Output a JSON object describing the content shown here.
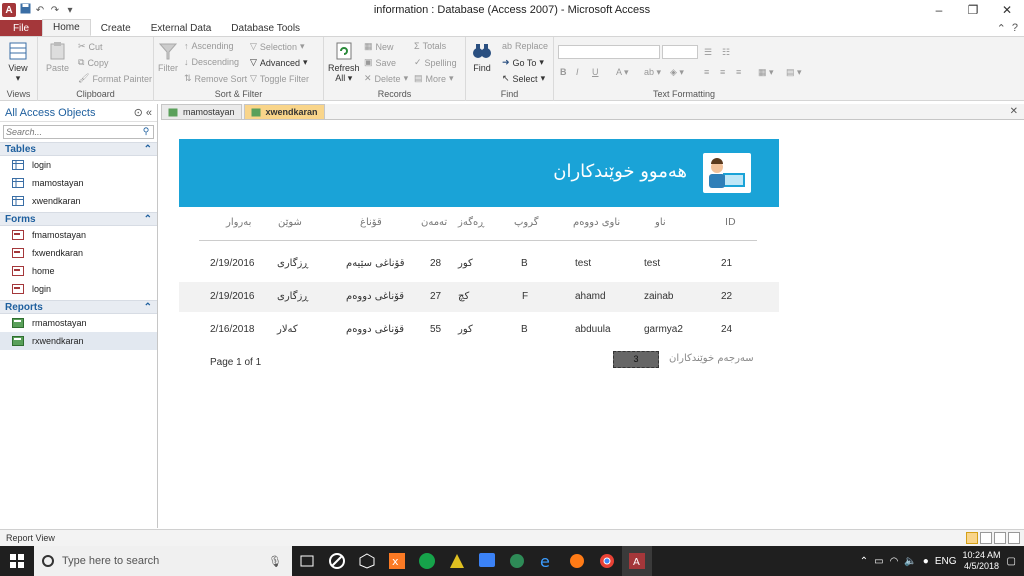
{
  "window": {
    "title": "information : Database (Access 2007) - Microsoft Access"
  },
  "ribbon_tabs": [
    "File",
    "Home",
    "Create",
    "External Data",
    "Database Tools"
  ],
  "ribbon": {
    "views": {
      "view_label": "View",
      "group_label": "Views"
    },
    "clipboard": {
      "paste": "Paste",
      "cut": "Cut",
      "copy": "Copy",
      "format_painter": "Format Painter",
      "group_label": "Clipboard"
    },
    "sort_filter": {
      "filter": "Filter",
      "ascending": "Ascending",
      "descending": "Descending",
      "remove_sort": "Remove Sort",
      "selection": "Selection",
      "advanced": "Advanced",
      "toggle_filter": "Toggle Filter",
      "group_label": "Sort & Filter"
    },
    "records": {
      "refresh": "Refresh",
      "refresh_all": "All",
      "new": "New",
      "save": "Save",
      "delete": "Delete",
      "totals": "Totals",
      "spelling": "Spelling",
      "more": "More",
      "group_label": "Records"
    },
    "find": {
      "find": "Find",
      "replace": "Replace",
      "go_to": "Go To",
      "select": "Select",
      "group_label": "Find"
    },
    "text_formatting": {
      "group_label": "Text Formatting"
    }
  },
  "nav": {
    "header": "All Access Objects",
    "search_placeholder": "Search...",
    "sections": [
      {
        "title": "Tables",
        "items": [
          "login",
          "mamostayan",
          "xwendkaran"
        ]
      },
      {
        "title": "Forms",
        "items": [
          "fmamostayan",
          "fxwendkaran",
          "home",
          "login"
        ]
      },
      {
        "title": "Reports",
        "items": [
          "rmamostayan",
          "rxwendkaran"
        ]
      }
    ]
  },
  "doc_tabs": [
    "mamostayan",
    "xwendkaran"
  ],
  "report": {
    "title": "هەموو خوێندکاران",
    "columns": {
      "id": "ID",
      "name": "ناو",
      "second_name": "ناوی دووەم",
      "group": "گروپ",
      "gender": "ڕەگەز",
      "age": "تەمەن",
      "stage": "قۆناغ",
      "place": "شوێن",
      "date": "بەروار"
    },
    "rows": [
      {
        "id": "21",
        "name": "test",
        "second_name": "test",
        "group": "B",
        "gender": "کور",
        "age": "28",
        "stage": "قۆناغی سێیەم",
        "place": "ڕزگاری",
        "date": "2/19/2016"
      },
      {
        "id": "22",
        "name": "zainab",
        "second_name": "ahamd",
        "group": "F",
        "gender": "کچ",
        "age": "27",
        "stage": "قۆناغی دووەم",
        "place": "ڕزگاری",
        "date": "2/19/2016"
      },
      {
        "id": "24",
        "name": "garmya2",
        "second_name": "abduula",
        "group": "B",
        "gender": "کور",
        "age": "55",
        "stage": "قۆناغی دووەم",
        "place": "کەلار",
        "date": "2/16/2018"
      }
    ],
    "page_info": "Page 1 of 1",
    "total_count": "3",
    "total_label": "سەرجەم خوێندکاران"
  },
  "status": {
    "text": "Report View"
  },
  "taskbar": {
    "search_placeholder": "Type here to search",
    "lang": "ENG",
    "time": "10:24 AM",
    "date": "4/5/2018"
  }
}
